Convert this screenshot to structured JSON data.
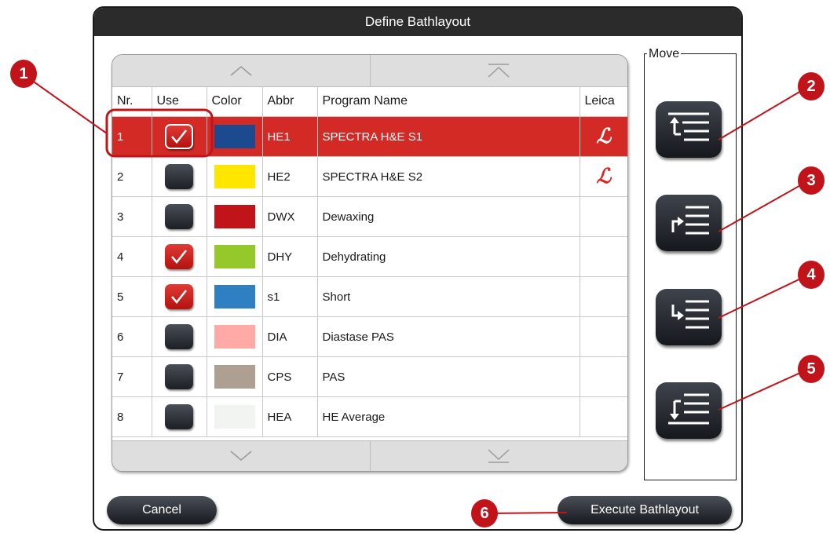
{
  "dialog": {
    "title": "Define Bathlayout",
    "cancel_label": "Cancel",
    "execute_label": "Execute Bathlayout",
    "move_label": "Move"
  },
  "table": {
    "columns": [
      "Nr.",
      "Use",
      "Color",
      "Abbr",
      "Program Name",
      "Leica"
    ],
    "rows": [
      {
        "nr": "1",
        "use": true,
        "color": "#1b4a8f",
        "abbr": "HE1",
        "name": "SPECTRA H&E S1",
        "leica": true,
        "leica_glyph": "ℒ",
        "selected": true
      },
      {
        "nr": "2",
        "use": false,
        "color": "#ffe600",
        "abbr": "HE2",
        "name": "SPECTRA H&E S2",
        "leica": true,
        "leica_glyph": "ℒ",
        "selected": false
      },
      {
        "nr": "3",
        "use": false,
        "color": "#c0141a",
        "abbr": "DWX",
        "name": "Dewaxing",
        "leica": false,
        "leica_glyph": "",
        "selected": false
      },
      {
        "nr": "4",
        "use": true,
        "color": "#95c82a",
        "abbr": "DHY",
        "name": "Dehydrating",
        "leica": false,
        "leica_glyph": "",
        "selected": false
      },
      {
        "nr": "5",
        "use": true,
        "color": "#2f80c3",
        "abbr": "s1",
        "name": "Short",
        "leica": false,
        "leica_glyph": "",
        "selected": false
      },
      {
        "nr": "6",
        "use": false,
        "color": "#ffaaa6",
        "abbr": "DIA",
        "name": "Diastase PAS",
        "leica": false,
        "leica_glyph": "",
        "selected": false
      },
      {
        "nr": "7",
        "use": false,
        "color": "#ad9f92",
        "abbr": "CPS",
        "name": "PAS",
        "leica": false,
        "leica_glyph": "",
        "selected": false
      },
      {
        "nr": "8",
        "use": false,
        "color": "#f2f4f1",
        "abbr": "HEA",
        "name": "HE Average",
        "leica": false,
        "leica_glyph": "",
        "selected": false
      }
    ]
  },
  "scroll": {
    "top_left_icon": "chevron-up-icon",
    "top_right_icon": "scroll-to-top-icon",
    "bottom_left_icon": "chevron-down-icon",
    "bottom_right_icon": "scroll-to-bottom-icon"
  },
  "move_buttons": [
    {
      "name": "move-to-top-button",
      "icon": "move-to-top-icon"
    },
    {
      "name": "move-up-button",
      "icon": "move-up-icon"
    },
    {
      "name": "move-down-button",
      "icon": "move-down-icon"
    },
    {
      "name": "move-to-bottom-button",
      "icon": "move-to-bottom-icon"
    }
  ],
  "annotations": [
    "1",
    "2",
    "3",
    "4",
    "5",
    "6"
  ],
  "colors": {
    "accent_red": "#d42a26",
    "annotation_red": "#c0141a",
    "button_dark": "#1c1f25"
  }
}
